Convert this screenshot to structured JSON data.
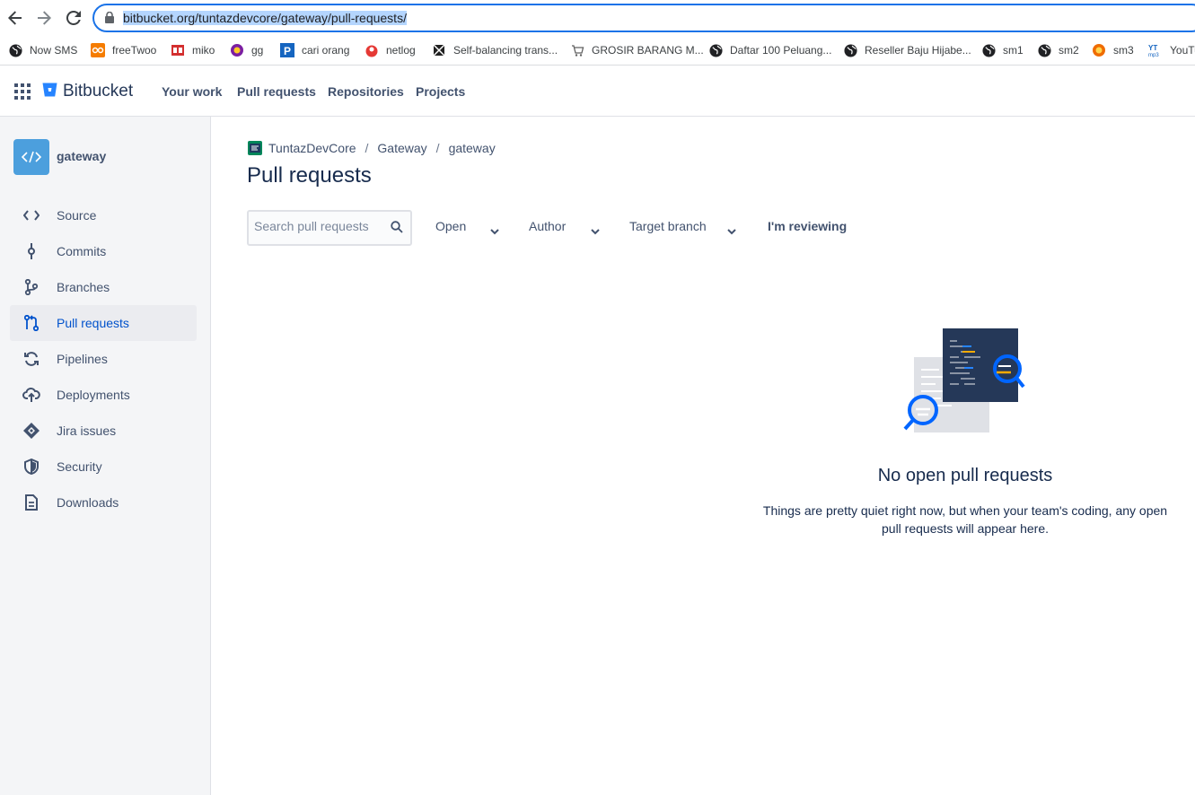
{
  "browser": {
    "url_prefix": "bitbucket.org/tuntazdevcore/gateway/pull-requests/",
    "bookmarks": [
      {
        "label": "Now SMS",
        "icon": "globe-icon"
      },
      {
        "label": "freeTwoo",
        "icon": "freetwoo-icon"
      },
      {
        "label": "miko",
        "icon": "miko-icon"
      },
      {
        "label": "gg",
        "icon": "gg-icon"
      },
      {
        "label": "cari orang",
        "icon": "p-icon"
      },
      {
        "label": "netlog",
        "icon": "netlog-icon"
      },
      {
        "label": "Self-balancing trans...",
        "icon": "robot-icon"
      },
      {
        "label": "GROSIR BARANG M...",
        "icon": "cart-icon"
      },
      {
        "label": "Daftar 100 Peluang...",
        "icon": "globe-icon"
      },
      {
        "label": "Reseller Baju Hijabe...",
        "icon": "globe-icon"
      },
      {
        "label": "sm1",
        "icon": "globe-icon"
      },
      {
        "label": "sm2",
        "icon": "globe-icon"
      },
      {
        "label": "sm3",
        "icon": "sm3-icon"
      },
      {
        "label": "YouTu",
        "icon": "youtube-mp3-icon"
      }
    ]
  },
  "header": {
    "product": "Bitbucket",
    "nav": [
      "Your work",
      "Pull requests",
      "Repositories",
      "Projects"
    ]
  },
  "sidebar": {
    "repo_name": "gateway",
    "items": [
      {
        "label": "Source",
        "icon": "code-icon"
      },
      {
        "label": "Commits",
        "icon": "commit-icon"
      },
      {
        "label": "Branches",
        "icon": "branch-icon"
      },
      {
        "label": "Pull requests",
        "icon": "pull-request-icon"
      },
      {
        "label": "Pipelines",
        "icon": "pipelines-icon"
      },
      {
        "label": "Deployments",
        "icon": "cloud-upload-icon"
      },
      {
        "label": "Jira issues",
        "icon": "jira-icon"
      },
      {
        "label": "Security",
        "icon": "shield-icon"
      },
      {
        "label": "Downloads",
        "icon": "document-icon"
      }
    ],
    "active": "Pull requests"
  },
  "main": {
    "breadcrumbs": [
      "TuntazDevCore",
      "Gateway",
      "gateway"
    ],
    "title": "Pull requests",
    "search_placeholder": "Search pull requests",
    "filters": {
      "state": "Open",
      "author": "Author",
      "target_branch": "Target branch",
      "reviewing": "I'm reviewing"
    },
    "empty": {
      "title": "No open pull requests",
      "description": "Things are pretty quiet right now, but when your team's coding, any open pull requests will appear here."
    }
  },
  "colors": {
    "accent": "#0052cc",
    "omnibox_border": "#1a73e8",
    "repo_avatar": "#4c9fdd"
  }
}
